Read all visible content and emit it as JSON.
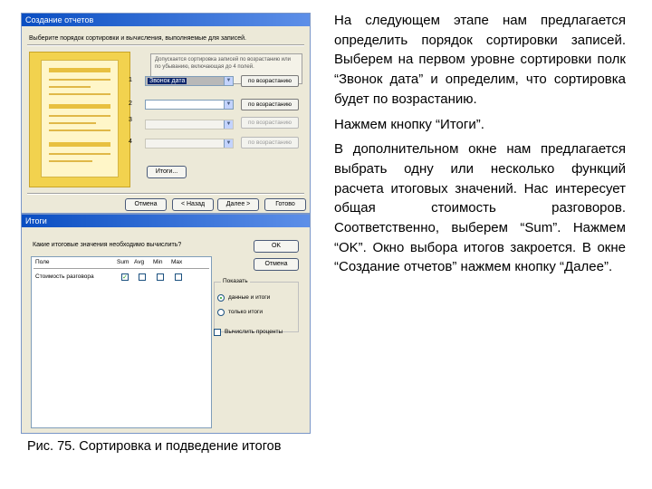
{
  "window1": {
    "title": "Создание отчетов",
    "description": "Выберите порядок сортировки и вычисления, выполняемые для записей.",
    "hint": "Допускается сортировка записей по возрастанию или по убыванию, включающая до 4 полей.",
    "levels": [
      "1",
      "2",
      "3",
      "4"
    ],
    "level1_value": "Звонок дата",
    "level2_value": "",
    "sort_label": "по возрастанию",
    "totals_button": "Итоги...",
    "buttons": {
      "cancel": "Отмена",
      "back": "< Назад",
      "next": "Далее >",
      "finish": "Готово"
    }
  },
  "window2": {
    "title": "Итоги",
    "question": "Какие итоговые значения необходимо вычислить?",
    "columns": {
      "field": "Поле",
      "sum": "Sum",
      "avg": "Avg",
      "min": "Min",
      "max": "Max"
    },
    "field_name": "Стоимость разговора",
    "checked": {
      "sum": true,
      "avg": false,
      "min": false,
      "max": false
    },
    "ok": "OK",
    "cancel": "Отмена",
    "show_group": "Показать",
    "radio_detail": "данные и итоги",
    "radio_totals": "только итоги",
    "percent_checkbox": "Вычислить проценты"
  },
  "text": {
    "p1": "На следующем этапе нам предлагается определить порядок сортировки записей. Выберем на первом уровне сортировки полк “Звонок дата” и определим, что сортировка будет по возрастанию.",
    "p2": "Нажмем кнопку “Итоги”.",
    "p3": "В дополнительном окне нам предлагается выбрать одну или несколько функций расчета итоговых значений. Нас интересует общая стоимость разговоров. Соответственно, выберем “Sum”. Нажмем “OK”. Окно выбора итогов закроется. В окне “Создание отчетов” нажмем кнопку “Далее”."
  },
  "caption": "Рис. 75. Сортировка и подведение итогов"
}
